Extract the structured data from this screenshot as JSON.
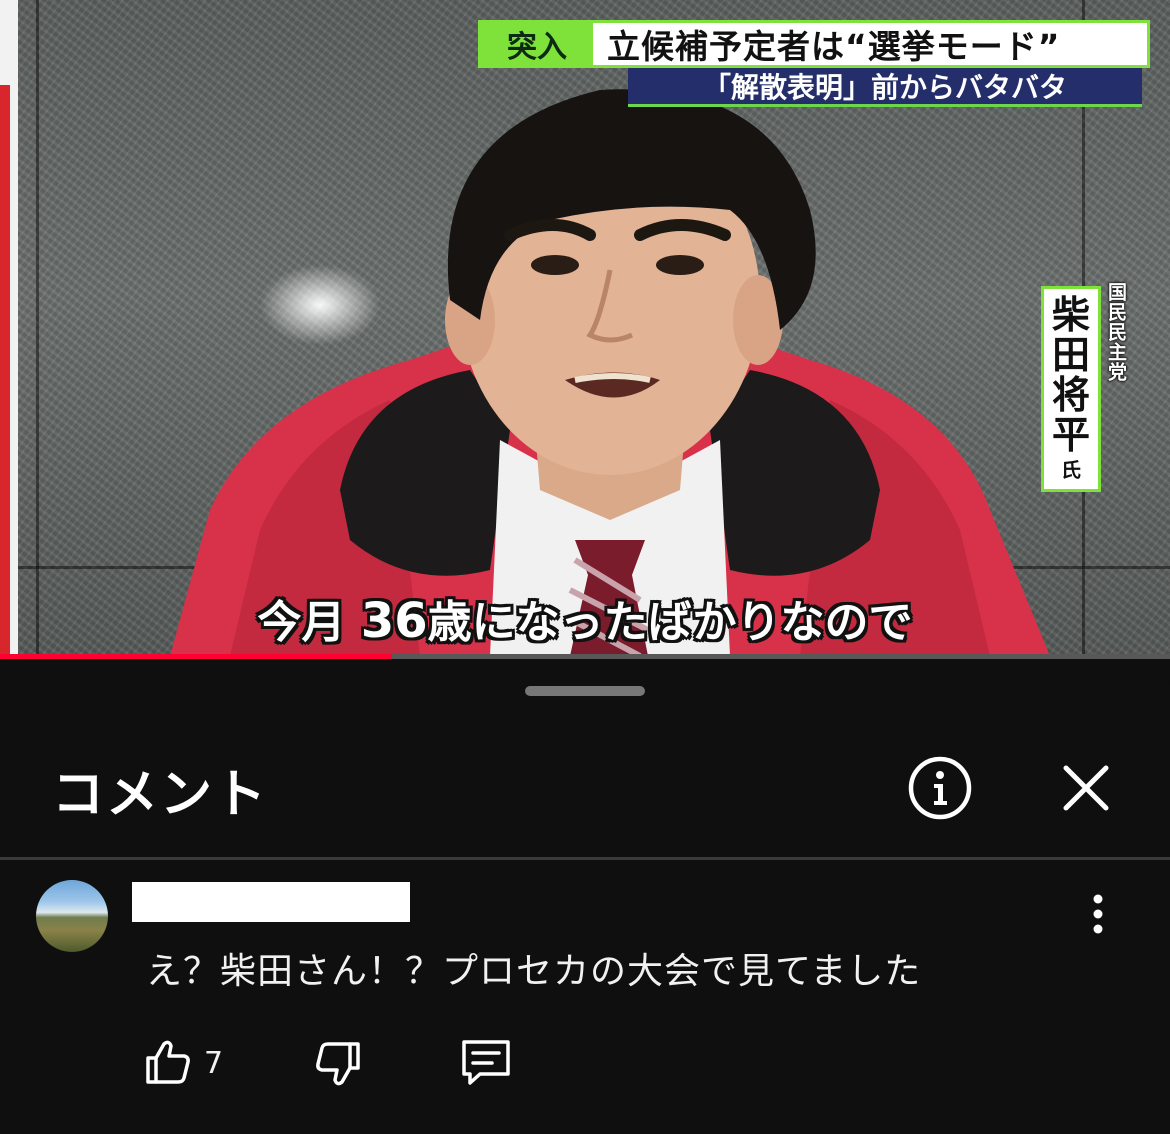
{
  "video": {
    "telop_tag": "突入",
    "telop_title": "立候補予定者は“選挙モード”",
    "telop_sub": "「解散表明」前からバタバタ",
    "name_chars": [
      "柴",
      "田",
      "将",
      "平"
    ],
    "name_suffix": "氏",
    "party": "国民民主党",
    "subtitle_pre": "今月 ",
    "subtitle_num": "36",
    "subtitle_post": "歳になったばかりなので",
    "progress": 0.335,
    "accent_color": "#ff0033",
    "telop_green": "#7ee23a"
  },
  "comments_panel": {
    "title": "コメント",
    "info_icon": "info-icon",
    "close_icon": "close-icon"
  },
  "comment": {
    "text": "え？柴田さん！？プロセカの大会で見てました",
    "likes": "7",
    "icons": [
      "thumbs-up-icon",
      "thumbs-down-icon",
      "reply-icon",
      "more-vertical-icon"
    ]
  }
}
